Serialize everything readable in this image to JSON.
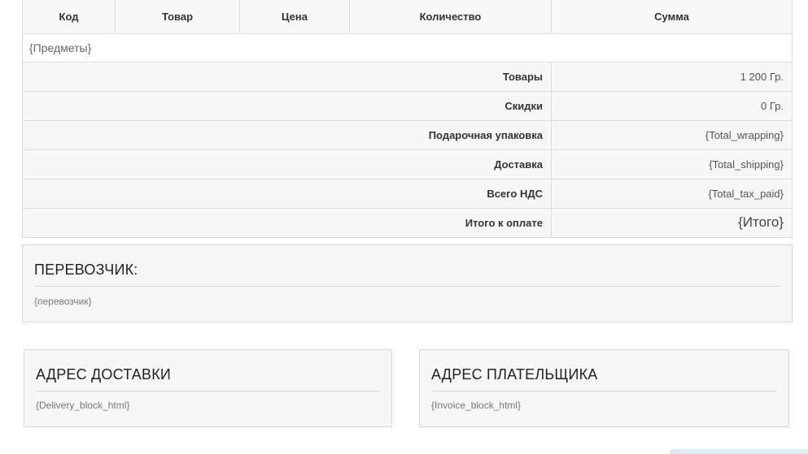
{
  "table": {
    "headers": [
      "Код",
      "Товар",
      "Цена",
      "Количество",
      "Сумма"
    ],
    "items_placeholder": "{Предметы}",
    "summary": [
      {
        "label": "Товары",
        "value": "1 200 Гр."
      },
      {
        "label": "Скидки",
        "value": "0 Гр."
      },
      {
        "label": "Подарочная упаковка",
        "value": "{Total_wrapping}"
      },
      {
        "label": "Доставка",
        "value": "{Total_shipping}"
      },
      {
        "label": "Всего НДС",
        "value": "{Total_tax_paid}"
      },
      {
        "label": "Итого к оплате",
        "value": "{Итого}"
      }
    ]
  },
  "carrier": {
    "title": "ПЕРЕВОЗЧИК:",
    "value": "{перевозчик}"
  },
  "delivery_address": {
    "title": "АДРЕС ДОСТАВКИ",
    "value": "{Delivery_block_html}"
  },
  "invoice_address": {
    "title": "АДРЕС ПЛАТЕЛЬЩИКА",
    "value": "{Invoice_block_html}"
  }
}
